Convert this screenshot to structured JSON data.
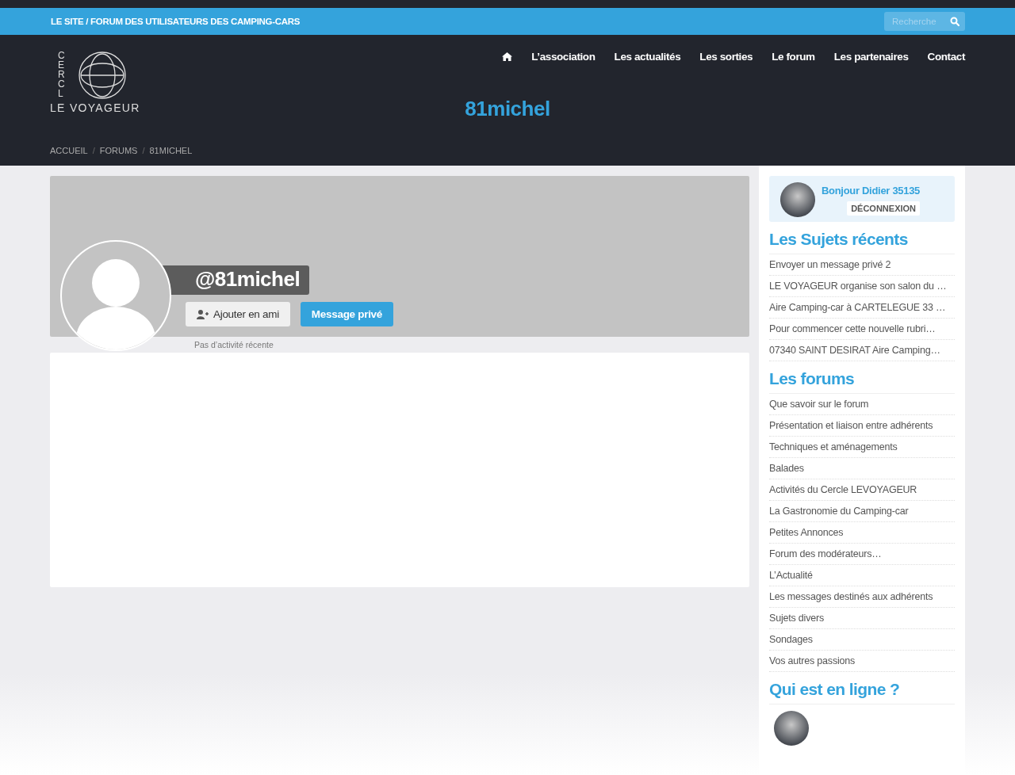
{
  "topbar": {
    "title": "LE SITE / FORUM DES UTILISATEURS DES CAMPING-CARS",
    "search": {
      "placeholder": "Recherche"
    }
  },
  "logo": {
    "vertical": "CERCL",
    "text": "LE VOYAGEUR"
  },
  "nav": [
    "L’association",
    "Les actualités",
    "Les sorties",
    "Le forum",
    "Les partenaires",
    "Contact"
  ],
  "page_title": "81michel",
  "breadcrumb": {
    "separator": "/",
    "items": [
      "ACCUEIL",
      "FORUMS",
      "81MICHEL"
    ]
  },
  "profile": {
    "username": "@81michel",
    "buttons": [
      {
        "label": "Ajouter en ami",
        "kind": "friend"
      },
      {
        "label": "Message privé",
        "kind": "primary"
      }
    ],
    "activity": "Pas d’activité récente"
  },
  "sidebar": {
    "greeting": "Bonjour Didier 35135",
    "logout": "DÉCONNEXION",
    "recent_title": "Les Sujets récents",
    "recent": [
      "Envoyer un message privé 2",
      "LE VOYAGEUR organise son salon du …",
      "Aire Camping-car à CARTELEGUE 33 …",
      "Pour commencer cette nouvelle rubri…",
      "07340 SAINT DESIRAT Aire Camping…"
    ],
    "forums_title": "Les forums",
    "forums": [
      "Que savoir sur le forum",
      "Présentation et liaison entre adhérents",
      "Techniques et aménagements",
      "Balades",
      "Activités du Cercle LEVOYAGEUR",
      "La Gastronomie du Camping-car",
      "Petites Annonces",
      "Forum des modérateurs…",
      "L’Actualité",
      "Les messages destinés aux adhérents",
      "Sujets divers",
      "Sondages",
      "Vos autres passions"
    ],
    "online_title": "Qui est en ligne ?"
  }
}
